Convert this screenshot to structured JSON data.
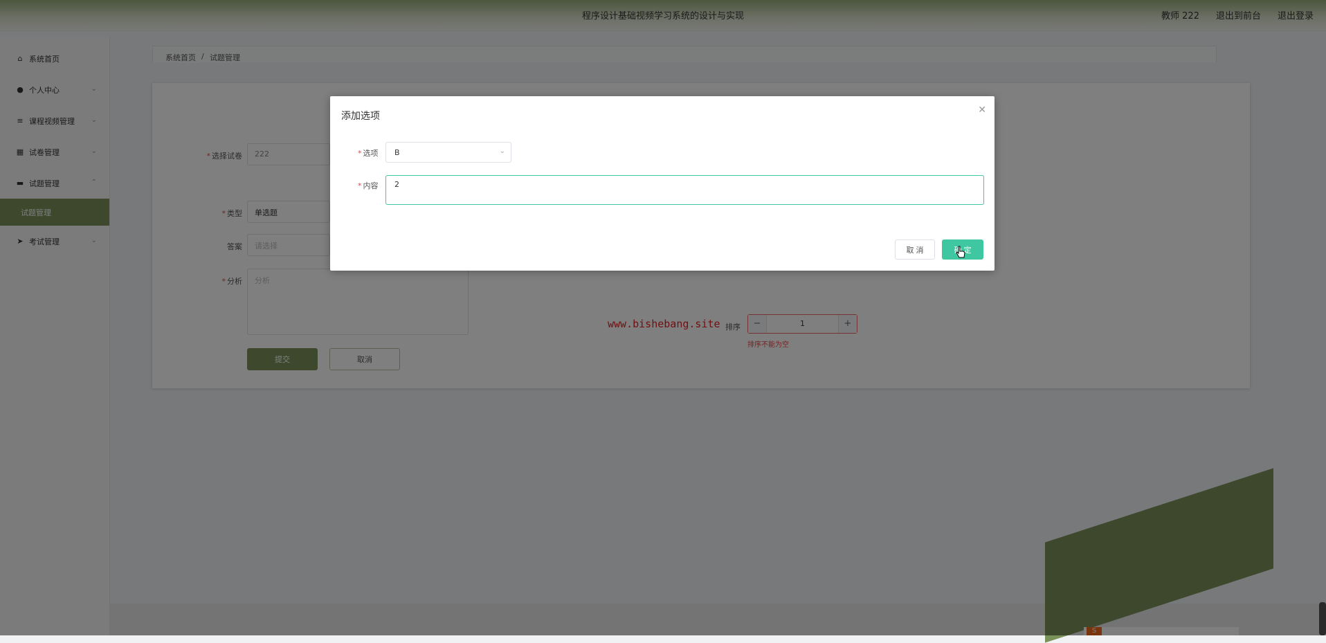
{
  "header": {
    "title": "程序设计基础视频学习系统的设计与实现",
    "user": "教师 222",
    "back_to_front": "退出到前台",
    "logout": "退出登录"
  },
  "sidebar": {
    "items": [
      {
        "label": "系统首页",
        "icon": "home-icon",
        "chevron": ""
      },
      {
        "label": "个人中心",
        "icon": "user-icon",
        "chevron": "⌄"
      },
      {
        "label": "课程视频管理",
        "icon": "list-icon",
        "chevron": "⌄"
      },
      {
        "label": "试卷管理",
        "icon": "grid-icon",
        "chevron": "⌄"
      },
      {
        "label": "试题管理",
        "icon": "comment-icon",
        "chevron": "⌃"
      },
      {
        "label": "考试管理",
        "icon": "send-icon",
        "chevron": "⌄"
      }
    ],
    "active_sub_item": "试题管理"
  },
  "breadcrumb": {
    "home": "系统首页",
    "separator": "/",
    "current": "试题管理"
  },
  "form": {
    "paper_label": "选择试卷",
    "paper_value": "222",
    "type_label": "类型",
    "type_value": "单选题",
    "answer_label": "答案",
    "answer_placeholder": "请选择",
    "analysis_label": "分析",
    "analysis_placeholder": "分析",
    "sort_label": "排序",
    "sort_value": "1",
    "sort_error": "排序不能为空",
    "submit_label": "提交",
    "cancel_label": "取消",
    "required_mark": "*"
  },
  "watermark": "www.bishebang.site",
  "dialog": {
    "title": "添加选项",
    "option_label": "选项",
    "option_value": "B",
    "content_label": "内容",
    "content_value": "2",
    "cancel_label": "取 消",
    "ok_label": "确 定"
  },
  "colors": {
    "accent": "#7b915a",
    "primary": "#3ec7a0",
    "error": "#e44444"
  }
}
